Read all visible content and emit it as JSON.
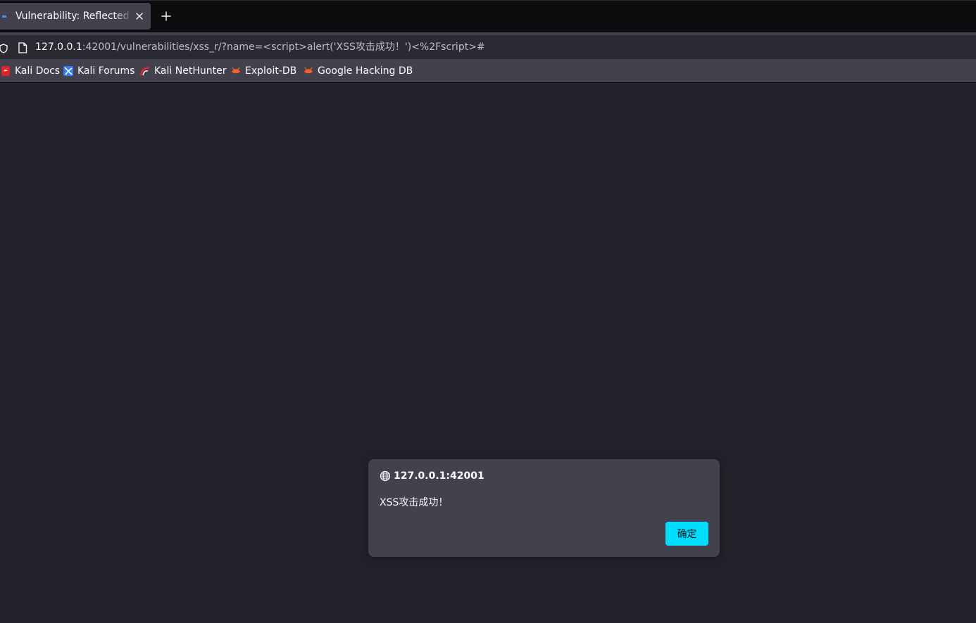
{
  "browser": {
    "tab": {
      "title": "Vulnerability: Reflected Cross Site Scripting (XSS)"
    },
    "url": {
      "host": "127.0.0.1",
      "rest": ":42001/vulnerabilities/xss_r/?name=<script>alert('XSS攻击成功！')<%2Fscript>#"
    },
    "bookmarks": [
      {
        "label": "Kali Docs",
        "icon": "kali-docs-icon",
        "color": "#e0232b"
      },
      {
        "label": "Kali Forums",
        "icon": "kali-forums-icon",
        "color": "#367bf0"
      },
      {
        "label": "Kali NetHunter",
        "icon": "kali-nethunter-icon",
        "color": "#e0232b"
      },
      {
        "label": "Exploit-DB",
        "icon": "exploit-db-icon",
        "color": "#f0642a"
      },
      {
        "label": "Google Hacking DB",
        "icon": "google-hacking-db-icon",
        "color": "#f0642a"
      }
    ]
  },
  "dialog": {
    "origin": "127.0.0.1:42001",
    "message": "XSS攻击成功！",
    "ok_label": "确定",
    "accent": "#00ddff"
  }
}
